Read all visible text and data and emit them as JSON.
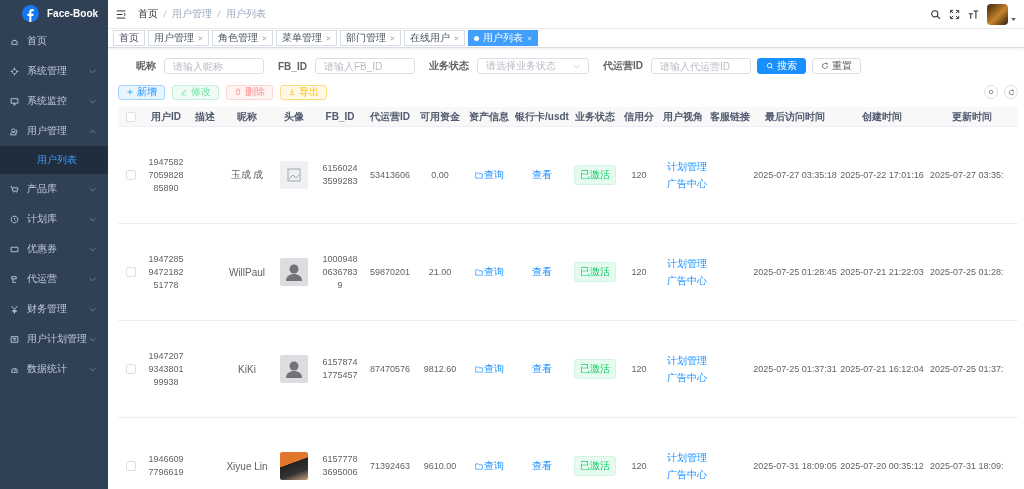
{
  "sidebar": {
    "logo_text": "Face-Book",
    "items": [
      {
        "label": "首页",
        "kind": "link"
      },
      {
        "label": "系统管理",
        "kind": "group",
        "expanded": false
      },
      {
        "label": "系统监控",
        "kind": "group",
        "expanded": false
      },
      {
        "label": "用户管理",
        "kind": "group",
        "expanded": true,
        "children": [
          {
            "label": "用户列表",
            "selected": true
          }
        ]
      },
      {
        "label": "产品库",
        "kind": "group",
        "expanded": false
      },
      {
        "label": "计划库",
        "kind": "group",
        "expanded": false
      },
      {
        "label": "优惠券",
        "kind": "group",
        "expanded": false
      },
      {
        "label": "代运营",
        "kind": "group",
        "expanded": false
      },
      {
        "label": "财务管理",
        "kind": "group",
        "expanded": false
      },
      {
        "label": "用户计划管理",
        "kind": "group",
        "expanded": false
      },
      {
        "label": "数据统计",
        "kind": "group",
        "expanded": false
      }
    ]
  },
  "breadcrumb": [
    "首页",
    "用户管理",
    "用户列表"
  ],
  "tags": [
    {
      "label": "首页",
      "selected": false,
      "closable": false
    },
    {
      "label": "用户管理",
      "selected": false,
      "closable": true
    },
    {
      "label": "角色管理",
      "selected": false,
      "closable": true
    },
    {
      "label": "菜单管理",
      "selected": false,
      "closable": true
    },
    {
      "label": "部门管理",
      "selected": false,
      "closable": true
    },
    {
      "label": "在线用户",
      "selected": false,
      "closable": true
    },
    {
      "label": "用户列表",
      "selected": true,
      "closable": true
    }
  ],
  "search_form": {
    "fields": [
      {
        "label": "昵称",
        "kind": "input",
        "placeholder": "请输入昵称"
      },
      {
        "label": "FB_ID",
        "kind": "input",
        "placeholder": "请输入FB_ID"
      },
      {
        "label": "业务状态",
        "kind": "select",
        "placeholder": "请选择业务状态"
      },
      {
        "label": "代运营ID",
        "kind": "input",
        "placeholder": "请输入代运营ID"
      }
    ],
    "search_button": "搜索",
    "reset_button": "重置"
  },
  "actions": [
    {
      "label": "新增",
      "kind": "primary",
      "disabled": false
    },
    {
      "label": "修改",
      "kind": "success",
      "disabled": true
    },
    {
      "label": "删除",
      "kind": "danger",
      "disabled": true
    },
    {
      "label": "导出",
      "kind": "warning",
      "disabled": false
    }
  ],
  "table": {
    "select_all": {
      "checked": false
    },
    "columns": [
      "用户ID",
      "描述",
      "昵称",
      "头像",
      "FB_ID",
      "代运营ID",
      "可用资金",
      "资产信息",
      "银行卡/usdt",
      "业务状态",
      "信用分",
      "用户视角",
      "客服链接",
      "最后访问时间",
      "创建时间",
      "更新时间"
    ],
    "rows": [
      {
        "checked": false,
        "user_id": "1947582705982885890",
        "nickname": "玉成 成",
        "avatar": {
          "kind": "image"
        },
        "fb_id": "61560243599283",
        "agent_id": "53413606",
        "funds": "0.00",
        "asset_link": "查询",
        "bank_link": "查看",
        "status": "已激活",
        "credit": "120",
        "view_links": [
          "计划管理",
          "广告中心"
        ],
        "last_visit": "2025-07-27 03:35:18",
        "created": "2025-07-22 17:01:16",
        "updated": "2025-07-27 03:35:"
      },
      {
        "checked": false,
        "user_id": "1947285947218251778",
        "nickname": "WillPaul",
        "avatar": {
          "kind": "silhouette"
        },
        "fb_id": "100094806367839",
        "agent_id": "59870201",
        "funds": "21.00",
        "asset_link": "查询",
        "bank_link": "查看",
        "status": "已激活",
        "credit": "120",
        "view_links": [
          "计划管理",
          "广告中心"
        ],
        "last_visit": "2025-07-25 01:28:45",
        "created": "2025-07-21 21:22:03",
        "updated": "2025-07-25 01:28:"
      },
      {
        "checked": false,
        "user_id": "1947207934380199938",
        "nickname": "KiKi",
        "avatar": {
          "kind": "silhouette"
        },
        "fb_id": "61578741775457",
        "agent_id": "87470576",
        "funds": "9812.60",
        "asset_link": "查询",
        "bank_link": "查看",
        "status": "已激活",
        "credit": "120",
        "view_links": [
          "计划管理",
          "广告中心"
        ],
        "last_visit": "2025-07-25 01:37:31",
        "created": "2025-07-21 16:12:04",
        "updated": "2025-07-25 01:37:"
      },
      {
        "checked": false,
        "user_id": "19466097796619",
        "nickname": "Xiyue Lin",
        "avatar": {
          "kind": "photo"
        },
        "fb_id": "61577783695006",
        "agent_id": "71392463",
        "funds": "9610.00",
        "asset_link": "查询",
        "bank_link": "查看",
        "status": "已激活",
        "credit": "120",
        "view_links": [
          "计划管理",
          "广告中心"
        ],
        "last_visit": "2025-07-31 18:09:05",
        "created": "2025-07-20 00:35:12",
        "updated": "2025-07-31 18:09:"
      }
    ]
  }
}
